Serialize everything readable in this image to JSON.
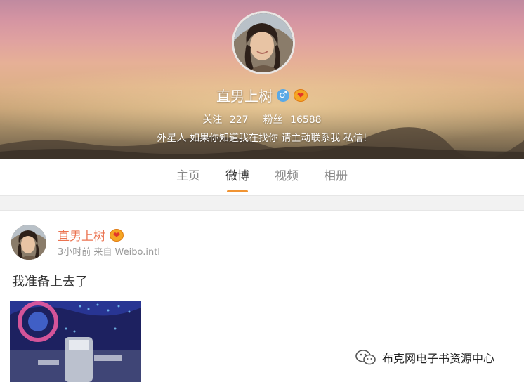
{
  "profile": {
    "name": "直男上树",
    "gender_symbol": "♂",
    "vip_symbol": "❤",
    "following_label": "关注",
    "following_count": "227",
    "fans_label": "粉丝",
    "fans_count": "16588",
    "bio": "外星人 如果你知道我在找你 请主动联系我 私信!"
  },
  "tabs": [
    {
      "label": "主页",
      "active": false
    },
    {
      "label": "微博",
      "active": true
    },
    {
      "label": "视频",
      "active": false
    },
    {
      "label": "相册",
      "active": false
    }
  ],
  "post": {
    "author": "直男上树",
    "vip_symbol": "❤",
    "meta": "3小时前 来自 Weibo.intl",
    "text": "我准备上去了"
  },
  "watermark": {
    "text": "布克网电子书资源中心",
    "icon": "wechat-icon"
  },
  "colors": {
    "accent": "#f19433",
    "author_name": "#eb7350"
  }
}
